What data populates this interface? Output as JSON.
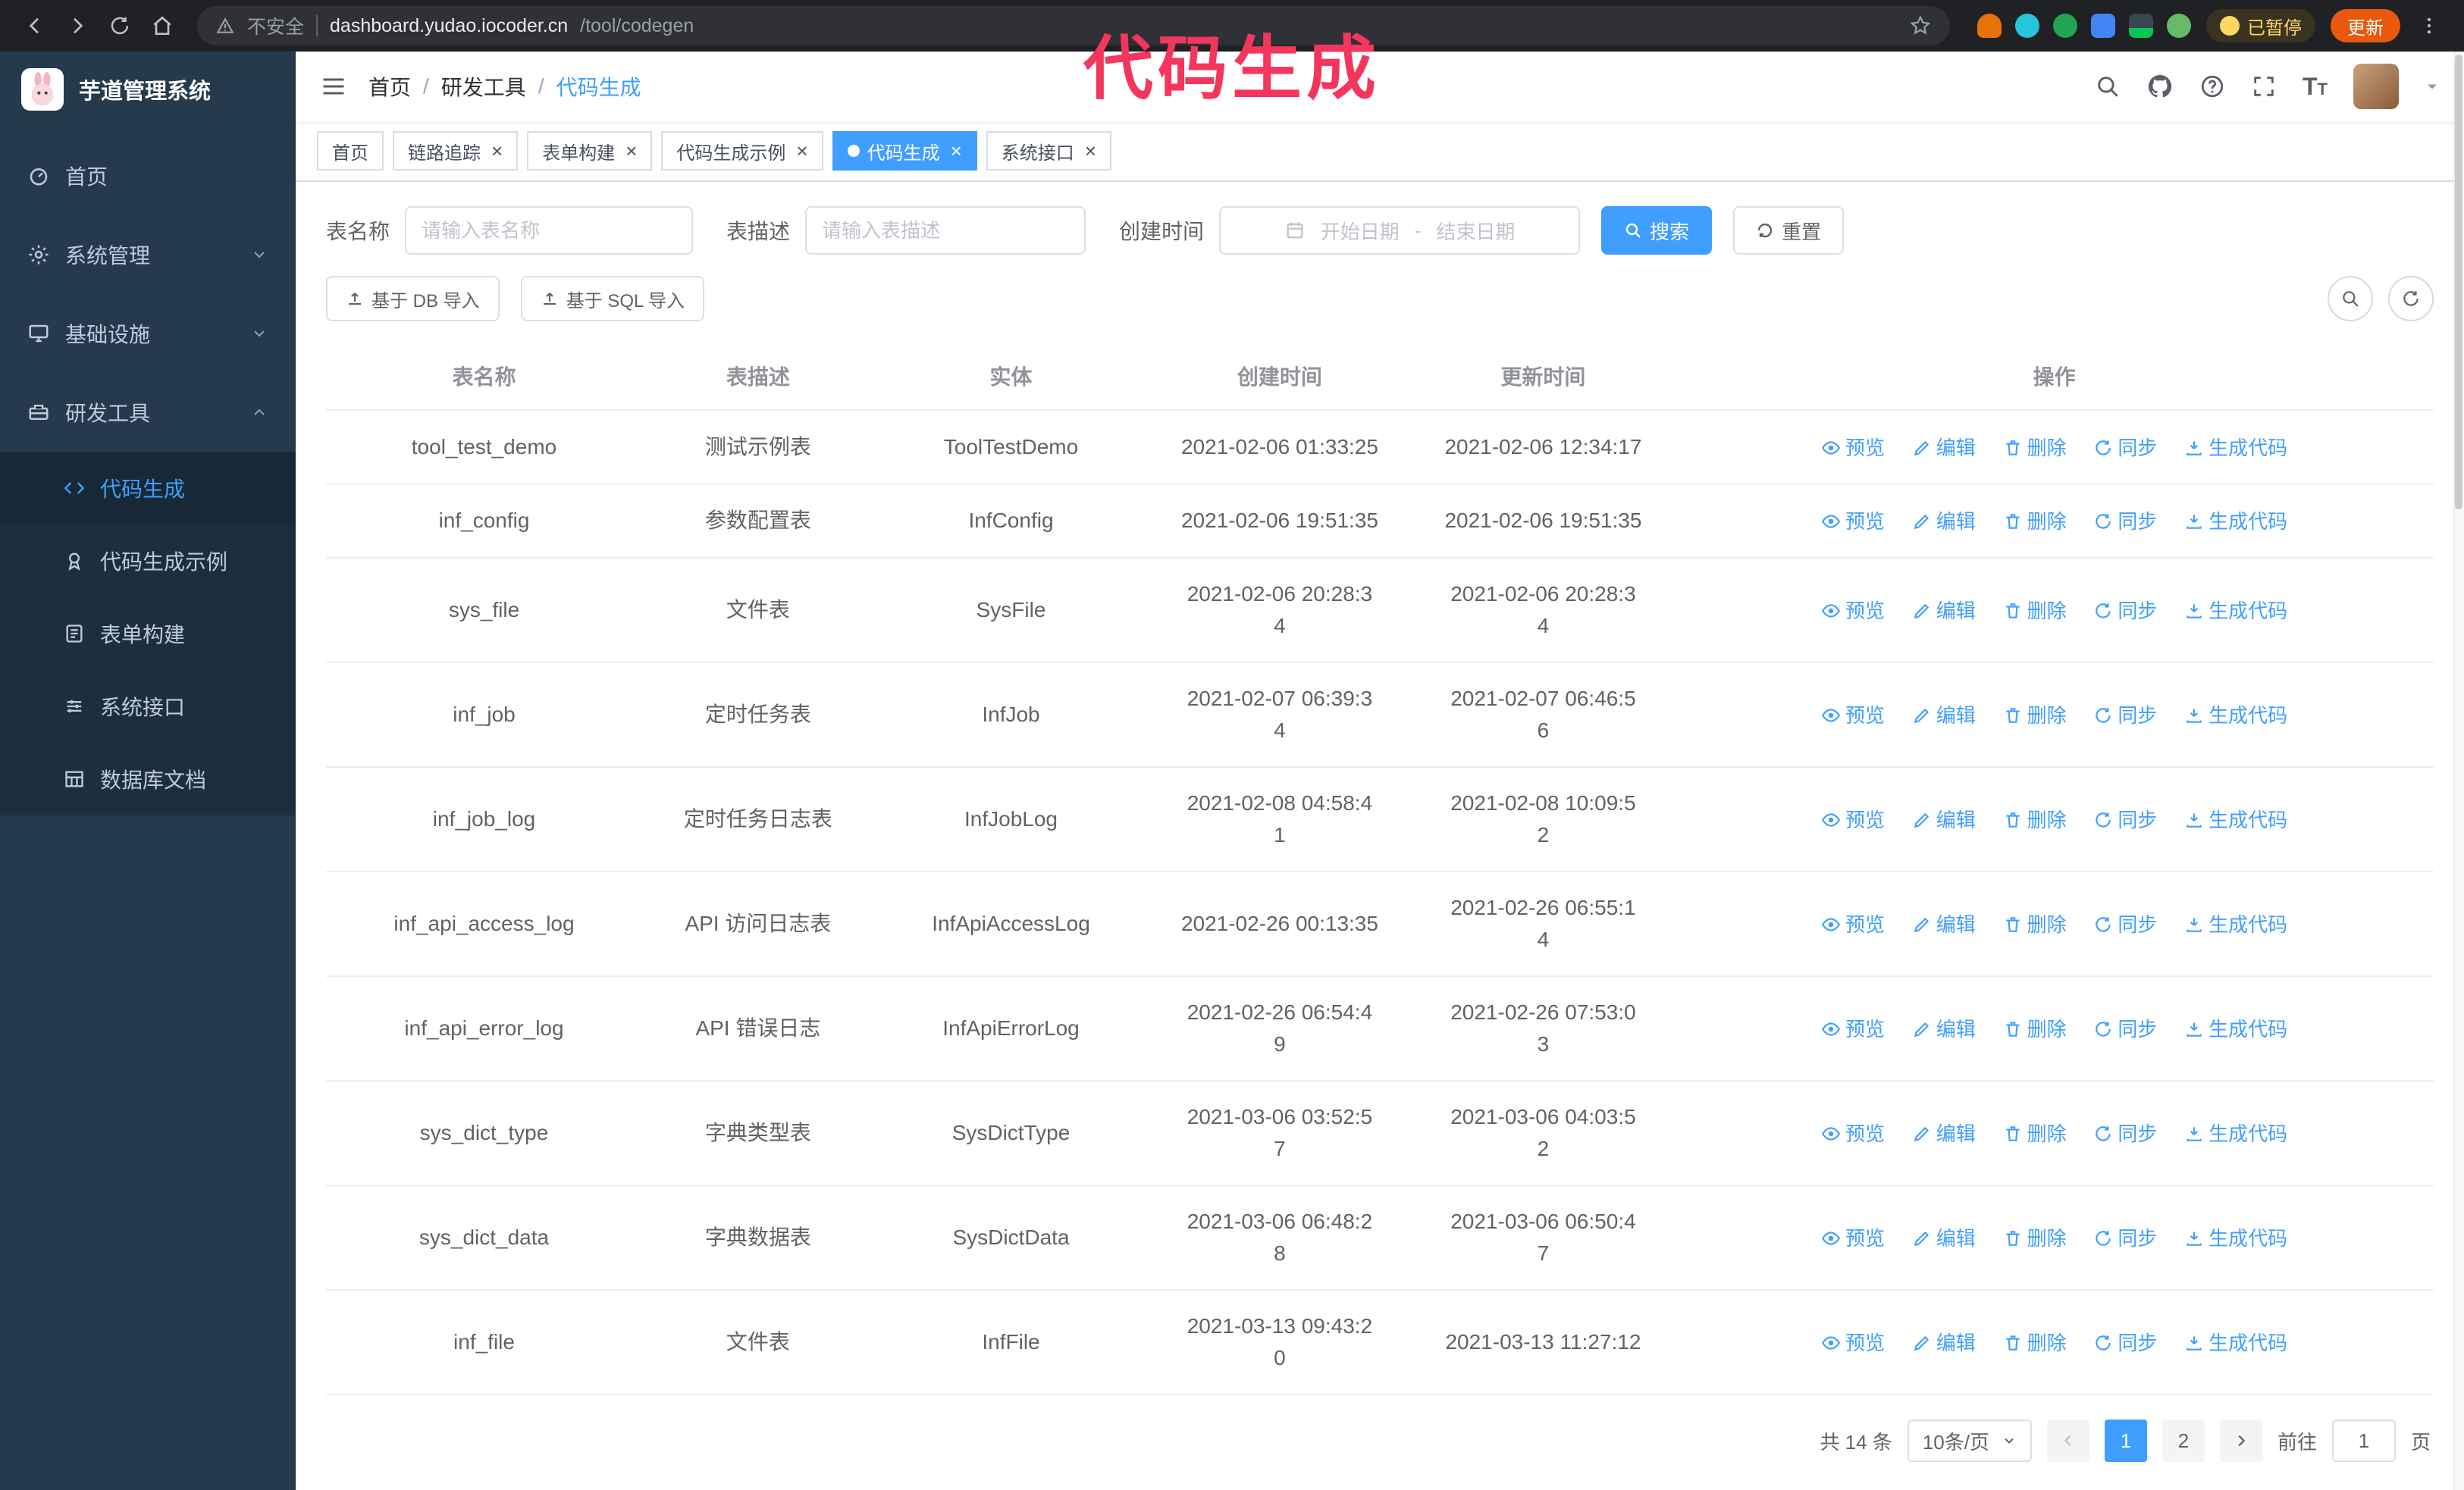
{
  "colors": {
    "accent": "#409eff",
    "annotation": "#f5365c",
    "sidebar_bg": "#263a4d",
    "submenu_bg": "#1d2f3f",
    "sidebar_text": "#bfcbd9",
    "browser_bar": "#202124",
    "update_btn": "#e8590c",
    "paused": "#fdd663"
  },
  "browser": {
    "warning_text": "不安全",
    "url_host": "dashboard.yudao.iocoder.cn",
    "url_path": "/tool/codegen",
    "paused_label": "已暂停",
    "update_label": "更新"
  },
  "annotation": {
    "text": "代码生成"
  },
  "sidebar": {
    "logo_title": "芋道管理系统",
    "items": [
      {
        "label": "首页"
      },
      {
        "label": "系统管理"
      },
      {
        "label": "基础设施"
      },
      {
        "label": "研发工具"
      }
    ],
    "submenu": [
      {
        "label": "代码生成"
      },
      {
        "label": "代码生成示例"
      },
      {
        "label": "表单构建"
      },
      {
        "label": "系统接口"
      },
      {
        "label": "数据库文档"
      }
    ]
  },
  "navbar": {
    "breadcrumb": [
      "首页",
      "研发工具",
      "代码生成"
    ],
    "separator": "/"
  },
  "tabs": [
    {
      "label": "首页"
    },
    {
      "label": "链路追踪"
    },
    {
      "label": "表单构建"
    },
    {
      "label": "代码生成示例"
    },
    {
      "label": "代码生成"
    },
    {
      "label": "系统接口"
    }
  ],
  "filters": {
    "table_name_label": "表名称",
    "table_name_placeholder": "请输入表名称",
    "table_desc_label": "表描述",
    "table_desc_placeholder": "请输入表描述",
    "create_time_label": "创建时间",
    "date_start_placeholder": "开始日期",
    "date_separator": "-",
    "date_end_placeholder": "结束日期",
    "search_button": "搜索",
    "reset_button": "重置"
  },
  "toolbar": {
    "import_db_button": "基于 DB 导入",
    "import_sql_button": "基于 SQL 导入"
  },
  "table": {
    "columns": [
      "表名称",
      "表描述",
      "实体",
      "创建时间",
      "更新时间",
      "操作"
    ],
    "actions": [
      "预览",
      "编辑",
      "删除",
      "同步",
      "生成代码"
    ],
    "rows": [
      {
        "name": "tool_test_demo",
        "desc": "测试示例表",
        "entity": "ToolTestDemo",
        "created": "2021-02-06 01:33:25",
        "updated": "2021-02-06 12:34:17"
      },
      {
        "name": "inf_config",
        "desc": "参数配置表",
        "entity": "InfConfig",
        "created": "2021-02-06 19:51:35",
        "updated": "2021-02-06 19:51:35"
      },
      {
        "name": "sys_file",
        "desc": "文件表",
        "entity": "SysFile",
        "created": "2021-02-06 20:28:3\n4",
        "updated": "2021-02-06 20:28:3\n4"
      },
      {
        "name": "inf_job",
        "desc": "定时任务表",
        "entity": "InfJob",
        "created": "2021-02-07 06:39:3\n4",
        "updated": "2021-02-07 06:46:5\n6"
      },
      {
        "name": "inf_job_log",
        "desc": "定时任务日志表",
        "entity": "InfJobLog",
        "created": "2021-02-08 04:58:4\n1",
        "updated": "2021-02-08 10:09:5\n2"
      },
      {
        "name": "inf_api_access_log",
        "desc": "API 访问日志表",
        "entity": "InfApiAccessLog",
        "created": "2021-02-26 00:13:35",
        "updated": "2021-02-26 06:55:1\n4"
      },
      {
        "name": "inf_api_error_log",
        "desc": "API 错误日志",
        "entity": "InfApiErrorLog",
        "created": "2021-02-26 06:54:4\n9",
        "updated": "2021-02-26 07:53:0\n3"
      },
      {
        "name": "sys_dict_type",
        "desc": "字典类型表",
        "entity": "SysDictType",
        "created": "2021-03-06 03:52:5\n7",
        "updated": "2021-03-06 04:03:5\n2"
      },
      {
        "name": "sys_dict_data",
        "desc": "字典数据表",
        "entity": "SysDictData",
        "created": "2021-03-06 06:48:2\n8",
        "updated": "2021-03-06 06:50:4\n7"
      },
      {
        "name": "inf_file",
        "desc": "文件表",
        "entity": "InfFile",
        "created": "2021-03-13 09:43:2\n0",
        "updated": "2021-03-13 11:27:12"
      }
    ]
  },
  "pagination": {
    "total_text": "共 14 条",
    "page_size": "10条/页",
    "pages": [
      "1",
      "2"
    ],
    "active_page": "1",
    "goto_prefix": "前往",
    "goto_value": "1",
    "goto_suffix": "页"
  }
}
